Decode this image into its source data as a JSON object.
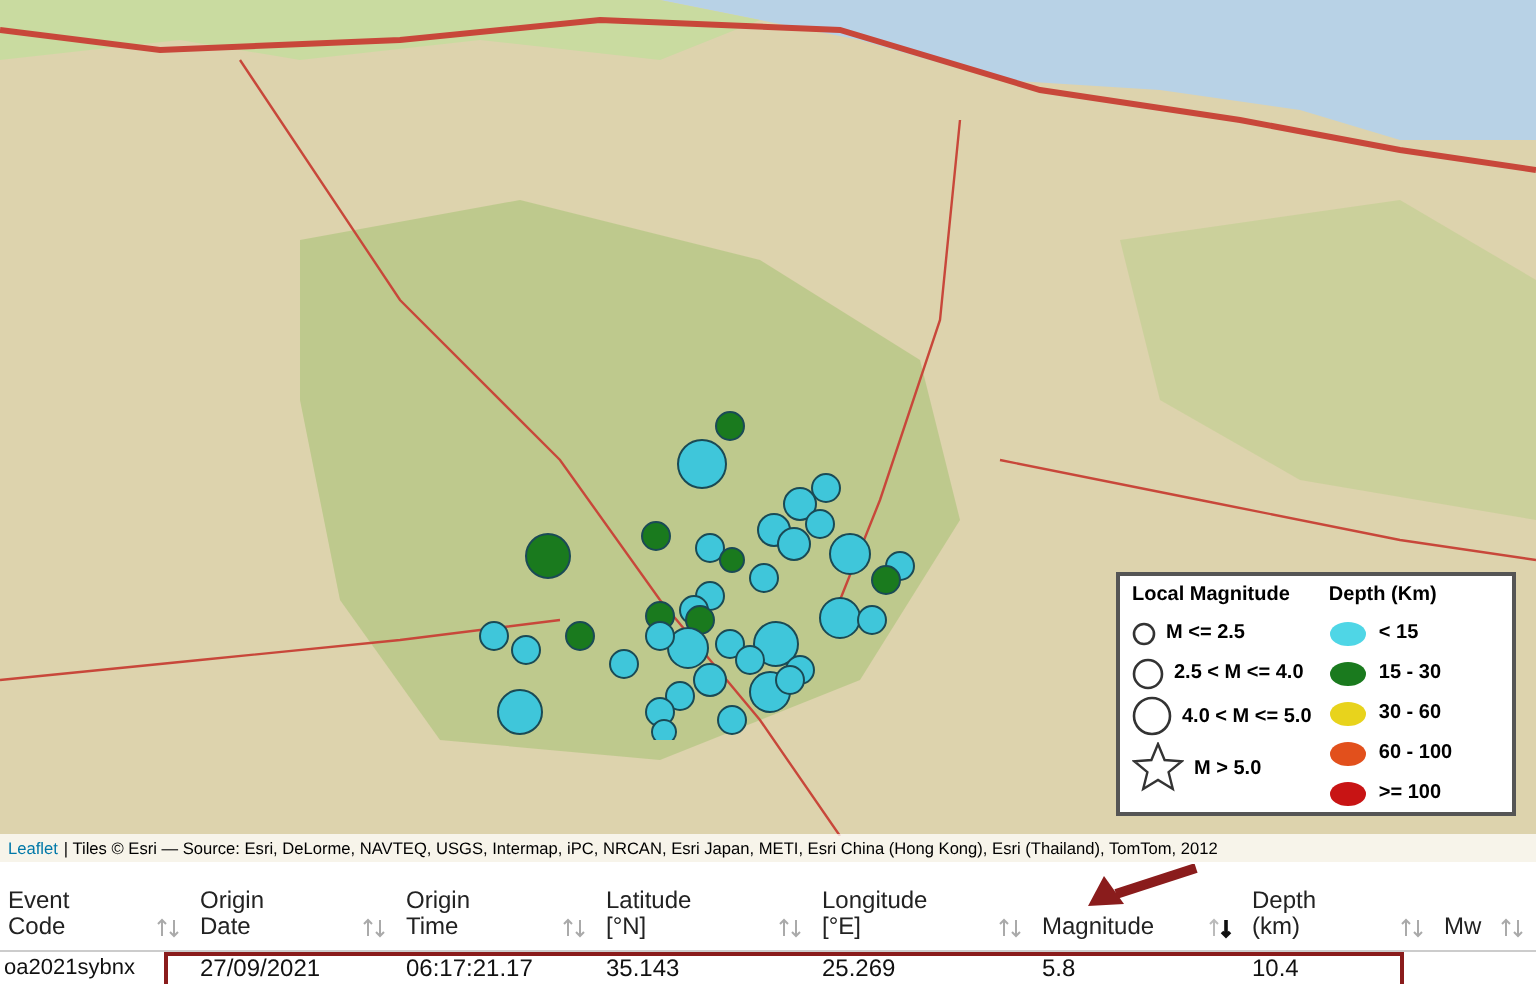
{
  "map": {
    "attribution": {
      "link": "Leaflet",
      "text": "| Tiles © Esri — Source: Esri, DeLorme, NAVTEQ, USGS, Intermap, iPC, NRCAN, Esri Japan, METI, Esri China (Hong Kong), Esri (Thailand), TomTom, 2012"
    },
    "legend": {
      "magnitude_title": "Local Magnitude",
      "depth_title": "Depth (Km)",
      "magnitude_classes": [
        {
          "kind": "small",
          "label": "M <= 2.5"
        },
        {
          "kind": "medium",
          "label": "2.5 < M <= 4.0"
        },
        {
          "kind": "large",
          "label": "4.0 < M <= 5.0"
        },
        {
          "kind": "star",
          "label": "M > 5.0"
        }
      ],
      "depth_classes": [
        {
          "label": "< 15",
          "color": "#4fd6e6"
        },
        {
          "label": "15 - 30",
          "color": "#1a7a1e"
        },
        {
          "label": "30 - 60",
          "color": "#e8d31c"
        },
        {
          "label": "60 - 100",
          "color": "#e2501c"
        },
        {
          "label": ">= 100",
          "color": "#c81414"
        }
      ]
    }
  },
  "table": {
    "columns": [
      {
        "label": "Event\nCode",
        "sorted": false
      },
      {
        "label": "Origin\nDate",
        "sorted": false
      },
      {
        "label": "Origin\nTime",
        "sorted": false
      },
      {
        "label": "Latitude\n[°N]",
        "sorted": false
      },
      {
        "label": "Longitude\n[°E]",
        "sorted": false
      },
      {
        "label": "Magnitude",
        "sorted": true
      },
      {
        "label": "Depth\n(km)",
        "sorted": false
      },
      {
        "label": "Mw",
        "sorted": false
      }
    ],
    "rows": [
      {
        "highlighted": true,
        "cells": [
          "oa2021sybnx",
          "27/09/2021",
          "06:17:21.17",
          "35.143",
          "25.269",
          "5.8",
          "10.4",
          ""
        ]
      }
    ]
  }
}
